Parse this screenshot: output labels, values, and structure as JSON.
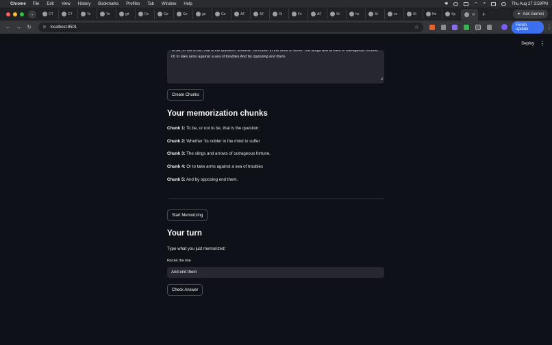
{
  "menubar": {
    "app": "Chrome",
    "items": [
      "File",
      "Edit",
      "View",
      "History",
      "Bookmarks",
      "Profiles",
      "Tab",
      "Window",
      "Help"
    ],
    "clock": "Thu Aug 27  3:59PM"
  },
  "tabs": [
    "CT",
    "CT",
    "Te",
    "Yo",
    "git",
    "Dc",
    "Ge",
    "Ge",
    "go",
    "Ge",
    "AF",
    "AF",
    "Oi",
    "Fe",
    "AF",
    "St",
    "ho",
    "St",
    "cu",
    "St",
    "Ne",
    "Sp",
    ""
  ],
  "browser": {
    "ask_gemini": "Ask Gemini",
    "url": "localhost:8501",
    "finish_update": "Finish update",
    "profile_initial": "V"
  },
  "app": {
    "deploy": "Deploy",
    "textarea_text": "To be, or not to be, that is the question: Whether 'tis nobler in the mind to suffer The slings and arrows of outrageous fortune, Or to take arms against a sea of troubles And by opposing end them.",
    "create_chunks": "Create Chunks",
    "chunks_heading": "Your memorization chunks",
    "chunks": [
      {
        "label": "Chunk 1:",
        "text": "To be, or not to be, that is the question:"
      },
      {
        "label": "Chunk 2:",
        "text": "Whether 'tis nobler in the mind to suffer"
      },
      {
        "label": "Chunk 3:",
        "text": "The slings and arrows of outrageous fortune,"
      },
      {
        "label": "Chunk 4:",
        "text": "Or to take arms against a sea of troubles"
      },
      {
        "label": "Chunk 5:",
        "text": "And by opposing end them."
      }
    ],
    "start_memorizing": "Start Memorizing",
    "turn_heading": "Your turn",
    "turn_instruction": "Type what you just memorized:",
    "recite_label": "Recite the line",
    "recite_value": "And end them",
    "check_answer": "Check Answer"
  }
}
